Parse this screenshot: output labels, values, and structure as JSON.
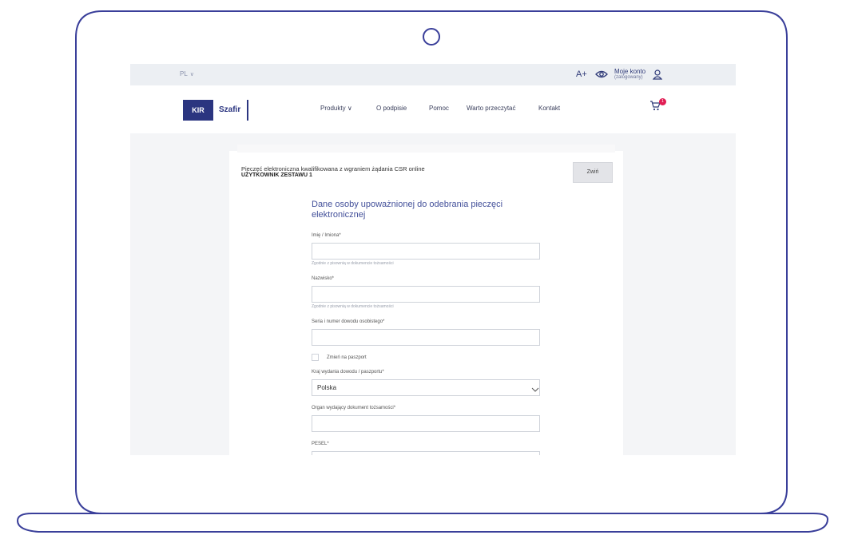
{
  "topbar": {
    "language": "PL",
    "font_size_label": "A+",
    "account_label": "Moje konto",
    "account_status": "(zalogowany)"
  },
  "brand": {
    "kir": "KIR",
    "name": "Szafir"
  },
  "nav": {
    "items": [
      "Produkty",
      "O podpisie",
      "Pomoc",
      "Warto przeczytać",
      "Kontakt"
    ],
    "cart_count": "1"
  },
  "product": {
    "title": "Pieczęć elektroniczna kwalifikowana z wgraniem żądania CSR online",
    "subtitle": "UŻYTKOWNIK ZESTAWU 1",
    "collapse_label": "Zwiń"
  },
  "form": {
    "section_title": "Dane osoby upoważnionej do odebrania pieczęci elektronicznej",
    "first_name_label": "Imię / Imiona*",
    "first_name_hint": "Zgodnie z pisownią w dokumencie tożsamości",
    "first_name_value": "",
    "last_name_label": "Nazwisko*",
    "last_name_hint": "Zgodnie z pisownią w dokumencie tożsamości",
    "last_name_value": "",
    "id_number_label": "Seria i numer dowodu osobistego*",
    "id_number_value": "",
    "passport_toggle_label": "Zmień na paszport",
    "country_label": "Kraj wydania dowodu / paszportu*",
    "country_value": "Polska",
    "issuer_label": "Organ wydający dokument tożsamości*",
    "issuer_value": "",
    "pesel_label": "PESEL*",
    "pesel_value": ""
  },
  "colors": {
    "frame": "#3a3f9a",
    "brand": "#2b3580",
    "badge": "#e11d54",
    "accent_text": "#43509a"
  }
}
